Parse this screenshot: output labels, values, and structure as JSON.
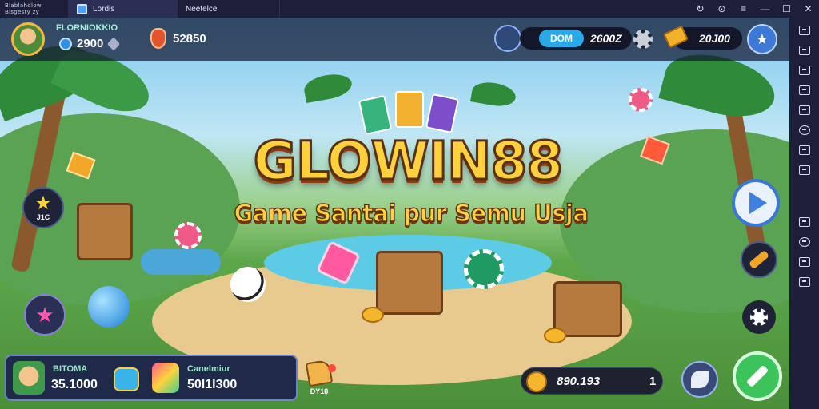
{
  "emulator": {
    "logo_lines": [
      "Blablahdlow",
      "Bisgesty zy"
    ],
    "tabs": [
      {
        "label": "Lordis",
        "icon": "app-tab-icon"
      },
      {
        "label": "Neetelce",
        "icon": "game-tab-icon"
      }
    ],
    "window_controls": [
      "↻",
      "⊙",
      "≡",
      "—",
      "☐",
      "✕"
    ],
    "right_rail": [
      "keyboard",
      "screenshot",
      "macro",
      "multi-instance",
      "location",
      "shake",
      "rotate",
      "sync",
      "volume",
      "back",
      "home",
      "recent"
    ]
  },
  "hud": {
    "player_name": "FLORNIOKKIO",
    "player_coins": "2900",
    "gems": "52850",
    "token_pill_label": "DOM",
    "token_pill_value": "2600Z",
    "gold_value": "20J00"
  },
  "title": {
    "main": "GLOWIN88",
    "subtitle": "Game Santai pur Semu Usja"
  },
  "left_menu": {
    "star_label": "J1C"
  },
  "bottom_panel": {
    "left_label": "BITOMA",
    "left_value": "35.1000",
    "right_label": "Canelmiur",
    "right_value": "50I1I300"
  },
  "bottom_bar": {
    "gift_label": "DY18",
    "balance_value": "890.193",
    "balance_suffix": "1"
  },
  "colors": {
    "title_yellow": "#ffd23d",
    "hud_bg": "#14162a",
    "accent_green": "#3cc35a",
    "accent_blue": "#3f7fe0",
    "rail_bg": "#1d1f38"
  }
}
